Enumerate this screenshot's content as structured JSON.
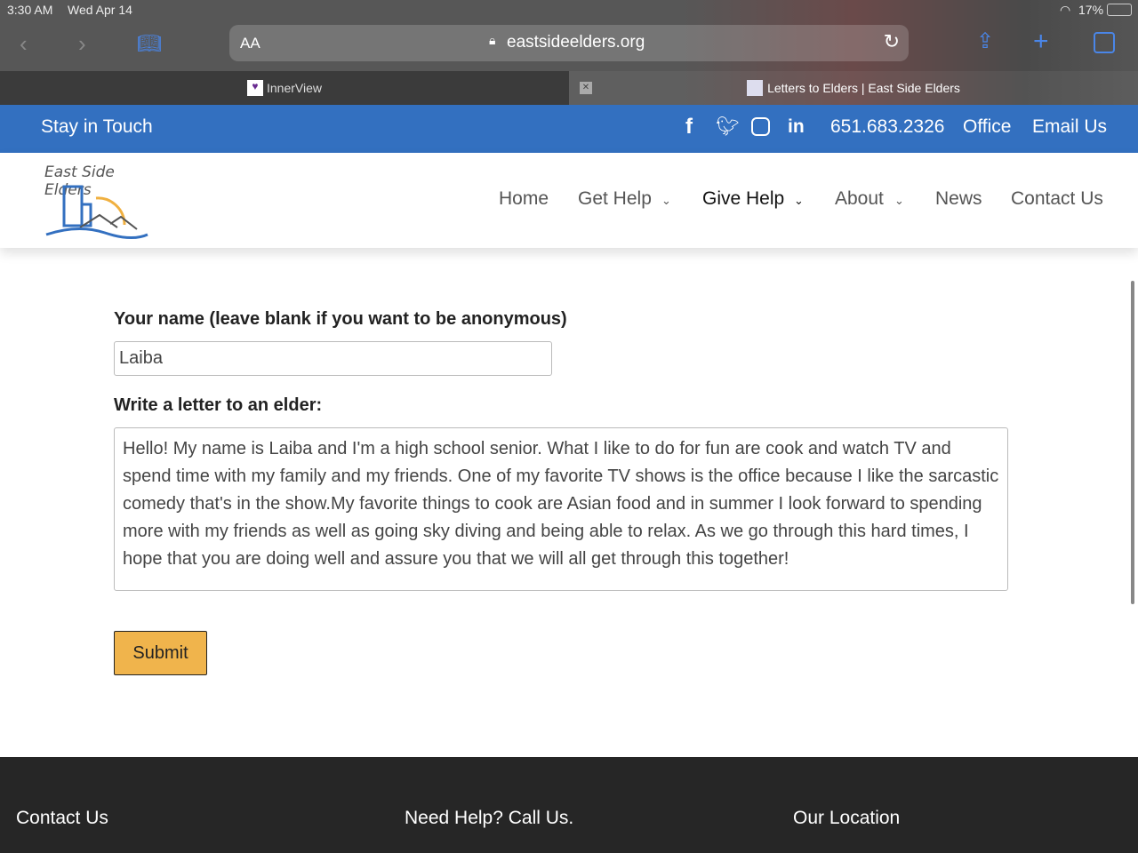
{
  "status": {
    "time": "3:30 AM",
    "date": "Wed Apr 14",
    "battery": "17%"
  },
  "browser": {
    "aa": "AA",
    "url": "eastsideelders.org",
    "tabs": [
      {
        "title": "InnerView"
      },
      {
        "title": "Letters to Elders | East Side Elders"
      }
    ],
    "tab_close": "✕"
  },
  "topbar": {
    "stay": "Stay in Touch",
    "phone": "651.683.2326",
    "office": "Office",
    "email": "Email Us"
  },
  "logo": {
    "text": "East Side Elders"
  },
  "nav": [
    {
      "label": "Home"
    },
    {
      "label": "Get Help"
    },
    {
      "label": "Give Help"
    },
    {
      "label": "About"
    },
    {
      "label": "News"
    },
    {
      "label": "Contact Us"
    }
  ],
  "form": {
    "name_label": "Your name (leave blank if you want to be anonymous)",
    "name_value": "Laiba",
    "letter_label": "Write a letter to an elder:",
    "letter_value": "Hello! My name is Laiba and I'm a high school senior. What I like to do for fun are cook and watch TV and spend time with my family and my friends. One of my favorite TV shows is the office because I like the sarcastic comedy that's in the show.My favorite things to cook are Asian food and in summer I look forward to spending more with my friends as well as going sky diving and being able to relax. As we go through this hard times, I hope that you are doing well and assure you that we will all get through this together!",
    "submit": "Submit"
  },
  "footer": {
    "contact": "Contact Us",
    "help": "Need Help?  Call Us.",
    "location": "Our Location"
  }
}
